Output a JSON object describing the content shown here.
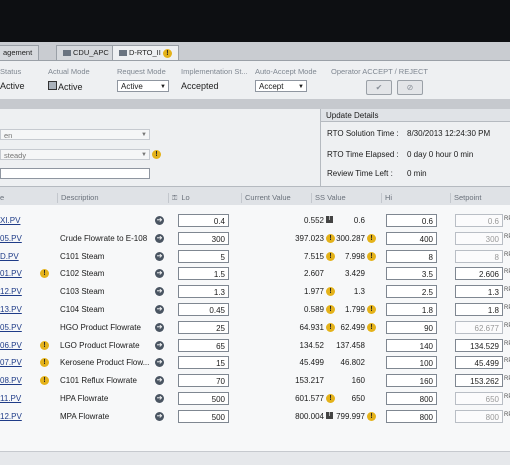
{
  "tabs": [
    {
      "label": "agement",
      "active": false
    },
    {
      "label": "CDU_APC",
      "active": false
    },
    {
      "label": "D-RTO_II",
      "active": true,
      "warning": true
    }
  ],
  "status_bar": {
    "status_label": "Status",
    "status_value": "Active",
    "actual_mode_label": "Actual Mode",
    "actual_mode_value": "Active",
    "request_mode_label": "Request Mode",
    "request_mode_value": "Active",
    "impl_label": "Implementation St...",
    "impl_value": "Accepted",
    "auto_accept_label": "Auto-Accept Mode",
    "auto_accept_value": "Accept",
    "operator_label": "Operator ACCEPT / REJECT",
    "accept_icon": "check-icon",
    "reject_icon": "reject-icon"
  },
  "left_panel": {
    "field1": "en",
    "field2": "steady",
    "field3": ""
  },
  "update_details": {
    "title": "Update Details",
    "solution_time_label": "RTO Solution Time :",
    "solution_time_value": "8/30/2013 12:24:30 PM",
    "elapsed_label": "RTO Time Elapsed :",
    "elapsed_value": "0 day 0 hour 0 min",
    "review_label": "Review Time Left :",
    "review_value": "0 min"
  },
  "grid_headers": {
    "tag": "e",
    "description": "Description",
    "lo": "Lo",
    "current_value": "Current Value",
    "ss_value": "SS Value",
    "hi": "Hi",
    "setpoint": "Setpoint"
  },
  "rows": [
    {
      "tag": "XI.PV",
      "warn": false,
      "desc": "",
      "lo": "0.4",
      "cv": "0.552",
      "cv_icon": "trend-icon",
      "ss": "0.6",
      "ss_warn": false,
      "hi": "0.6",
      "sp": "0.6",
      "sp_active": false
    },
    {
      "tag": "05.PV",
      "warn": false,
      "desc": "Crude Flowrate to E-108",
      "lo": "300",
      "cv": "397.023",
      "cv_icon": "warn",
      "ss": "300.287",
      "ss_warn": true,
      "hi": "400",
      "sp": "300",
      "sp_active": false
    },
    {
      "tag": "D.PV",
      "warn": false,
      "desc": "C101 Steam",
      "lo": "5",
      "cv": "7.515",
      "cv_icon": "warn",
      "ss": "7.998",
      "ss_warn": true,
      "hi": "8",
      "sp": "8",
      "sp_active": false
    },
    {
      "tag": "01.PV",
      "warn": true,
      "desc": "C102 Steam",
      "lo": "1.5",
      "cv": "2.607",
      "cv_icon": "",
      "ss": "3.429",
      "ss_warn": false,
      "hi": "3.5",
      "sp": "2.606",
      "sp_active": true
    },
    {
      "tag": "12.PV",
      "warn": false,
      "desc": "C103 Steam",
      "lo": "1.3",
      "cv": "1.977",
      "cv_icon": "warn",
      "ss": "1.3",
      "ss_warn": false,
      "hi": "2.5",
      "sp": "1.3",
      "sp_active": true
    },
    {
      "tag": "13.PV",
      "warn": false,
      "desc": "C104 Steam",
      "lo": "0.45",
      "cv": "0.589",
      "cv_icon": "warn",
      "ss": "1.799",
      "ss_warn": true,
      "hi": "1.8",
      "sp": "1.8",
      "sp_active": true
    },
    {
      "tag": "05.PV",
      "warn": false,
      "desc": "HGO Product Flowrate",
      "lo": "25",
      "cv": "64.931",
      "cv_icon": "warn",
      "ss": "62.499",
      "ss_warn": true,
      "hi": "90",
      "sp": "62.677",
      "sp_active": false
    },
    {
      "tag": "06.PV",
      "warn": true,
      "desc": "LGO Product Flowrate",
      "lo": "65",
      "cv": "134.52",
      "cv_icon": "",
      "ss": "137.458",
      "ss_warn": false,
      "hi": "140",
      "sp": "134.529",
      "sp_active": true
    },
    {
      "tag": "07.PV",
      "warn": true,
      "desc": "Kerosene Product Flow...",
      "lo": "15",
      "cv": "45.499",
      "cv_icon": "",
      "ss": "46.802",
      "ss_warn": false,
      "hi": "100",
      "sp": "45.499",
      "sp_active": true
    },
    {
      "tag": "08.PV",
      "warn": true,
      "desc": "C101 Reflux Flowrate",
      "lo": "70",
      "cv": "153.217",
      "cv_icon": "",
      "ss": "160",
      "ss_warn": false,
      "hi": "160",
      "sp": "153.262",
      "sp_active": true
    },
    {
      "tag": "11.PV",
      "warn": false,
      "desc": "HPA Flowrate",
      "lo": "500",
      "cv": "601.577",
      "cv_icon": "warn",
      "ss": "650",
      "ss_warn": false,
      "hi": "800",
      "sp": "650",
      "sp_active": false
    },
    {
      "tag": "12.PV",
      "warn": false,
      "desc": "MPA Flowrate",
      "lo": "500",
      "cv": "800.004",
      "cv_icon": "trend-icon",
      "ss": "799.997",
      "ss_warn": true,
      "hi": "800",
      "sp": "800",
      "sp_active": false
    }
  ],
  "unit_label": "RP"
}
